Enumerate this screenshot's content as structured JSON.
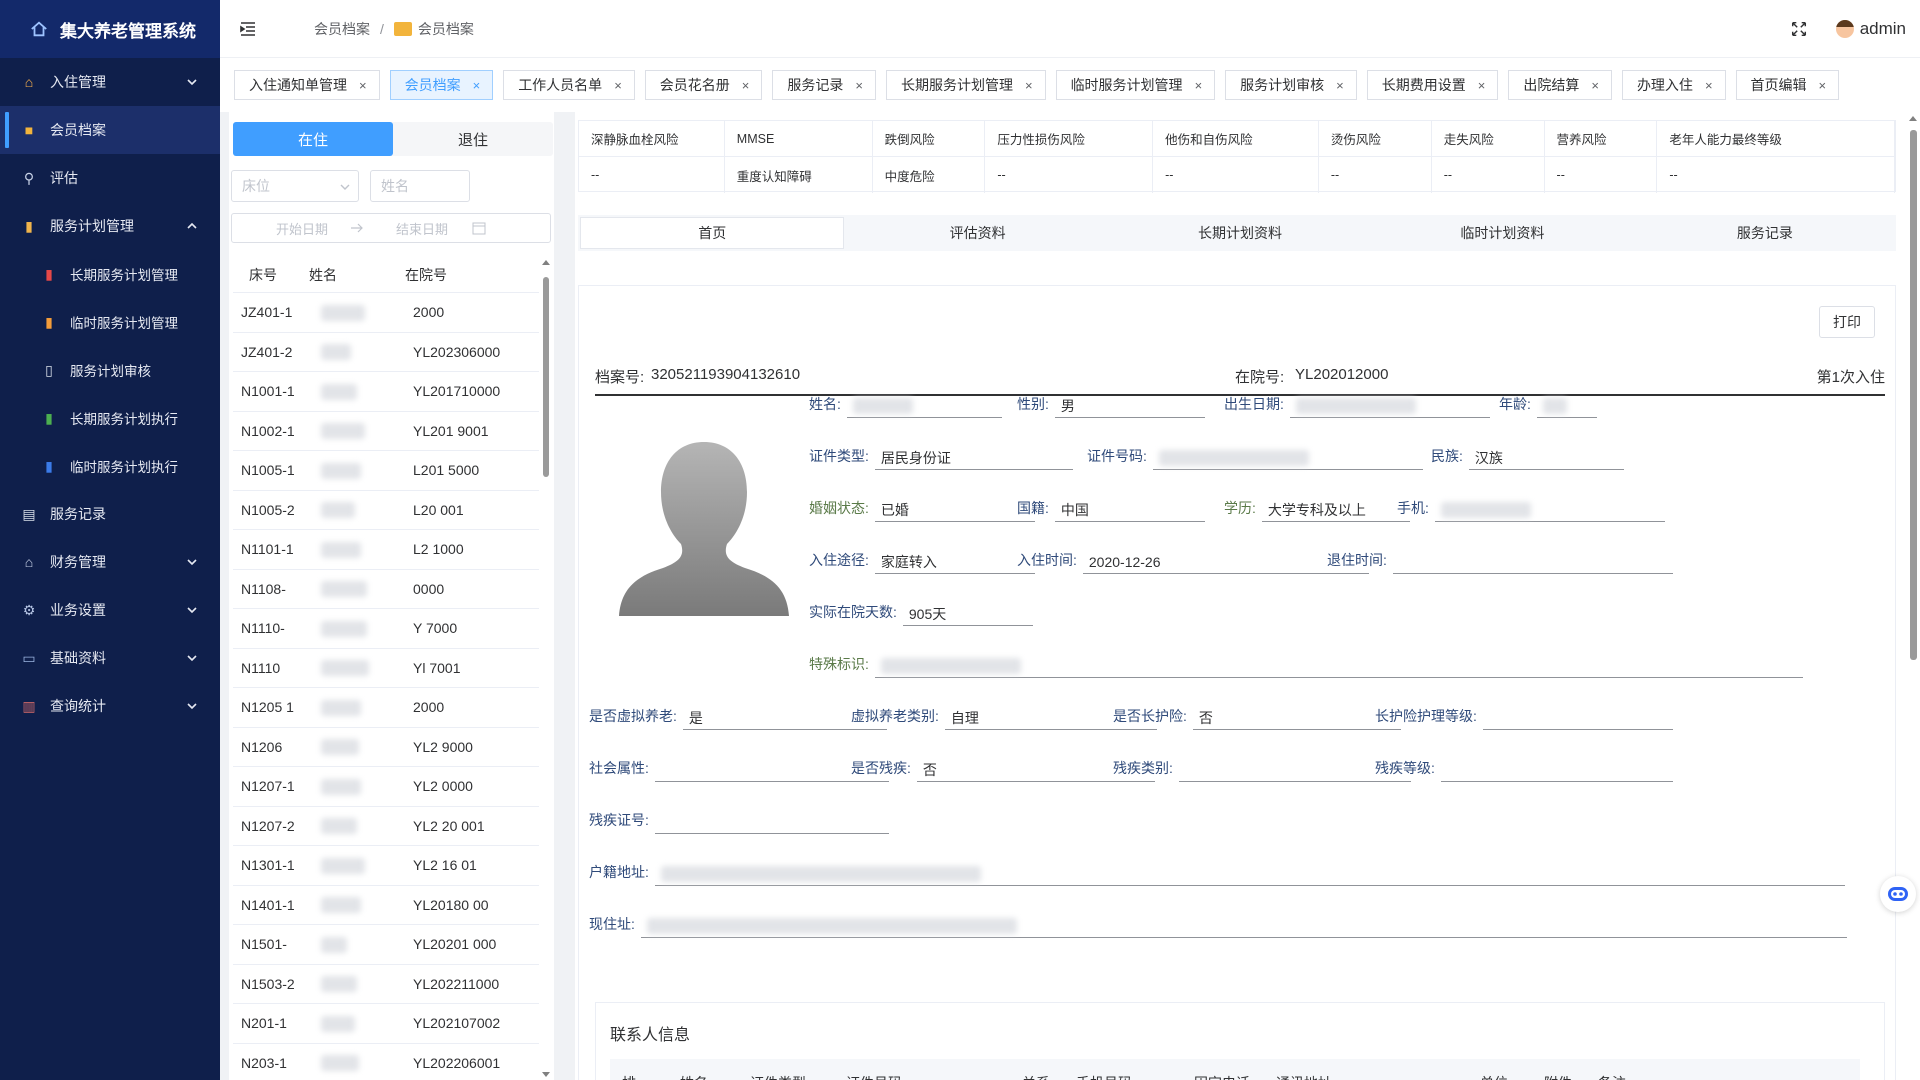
{
  "app": {
    "title": "集大养老管理系统"
  },
  "sidebar": {
    "items": [
      {
        "label": "入住管理",
        "icon": "home-icon",
        "has_caret": true,
        "caret": "down"
      },
      {
        "label": "会员档案",
        "icon": "folder-icon",
        "active": true
      },
      {
        "label": "评估",
        "icon": "magnifier-icon"
      },
      {
        "label": "服务计划管理",
        "icon": "notebook-icon",
        "has_caret": true,
        "caret": "up"
      },
      {
        "label": "长期服务计划管理",
        "icon": "red-book-icon",
        "sub": true
      },
      {
        "label": "临时服务计划管理",
        "icon": "orange-book-icon",
        "sub": true
      },
      {
        "label": "服务计划审核",
        "icon": "page-icon",
        "sub": true
      },
      {
        "label": "长期服务计划执行",
        "icon": "green-book-icon",
        "sub": true
      },
      {
        "label": "临时服务计划执行",
        "icon": "blue-book-icon",
        "sub": true
      },
      {
        "label": "服务记录",
        "icon": "document-icon"
      },
      {
        "label": "财务管理",
        "icon": "bank-icon",
        "has_caret": true,
        "caret": "down"
      },
      {
        "label": "业务设置",
        "icon": "gear-icon",
        "has_caret": true,
        "caret": "down"
      },
      {
        "label": "基础资料",
        "icon": "laptop-icon",
        "has_caret": true,
        "caret": "down"
      },
      {
        "label": "查询统计",
        "icon": "bar-chart-icon",
        "has_caret": true,
        "caret": "down"
      }
    ]
  },
  "header": {
    "breadcrumb": [
      "会员档案",
      "会员档案"
    ],
    "user": "admin"
  },
  "tags": [
    {
      "label": "入住通知单管理"
    },
    {
      "label": "会员档案",
      "active": true
    },
    {
      "label": "工作人员名单"
    },
    {
      "label": "会员花名册"
    },
    {
      "label": "服务记录"
    },
    {
      "label": "长期服务计划管理"
    },
    {
      "label": "临时服务计划管理"
    },
    {
      "label": "服务计划审核"
    },
    {
      "label": "长期费用设置"
    },
    {
      "label": "出院结算"
    },
    {
      "label": "办理入住"
    },
    {
      "label": "首页编辑"
    }
  ],
  "tag_close": "×",
  "left": {
    "seg_in": "在住",
    "seg_out": "退住",
    "bed_placeholder": "床位",
    "name_placeholder": "姓名",
    "start_date": "开始日期",
    "end_date": "结束日期",
    "cols": [
      "床号",
      "姓名",
      "在院号"
    ],
    "rows": [
      {
        "bed": "JZ401-1",
        "no": "2000"
      },
      {
        "bed": "JZ401-2",
        "no": "YL202306000"
      },
      {
        "bed": "N1001-1",
        "no": "YL201710000"
      },
      {
        "bed": "N1002-1",
        "no": "YL201 9001"
      },
      {
        "bed": "N1005-1",
        "no": "L201 5000"
      },
      {
        "bed": "N1005-2",
        "no": "L20 001"
      },
      {
        "bed": "N1101-1",
        "no": "L2 1000"
      },
      {
        "bed": "N1108-",
        "no": "0000"
      },
      {
        "bed": "N1110-",
        "no": "Y 7000"
      },
      {
        "bed": "N1110",
        "no": "Yl 7001"
      },
      {
        "bed": "N1205 1",
        "no": "2000"
      },
      {
        "bed": "N1206",
        "no": "YL2 9000"
      },
      {
        "bed": "N1207-1",
        "no": "YL2 0000"
      },
      {
        "bed": "N1207-2",
        "no": "YL2 20 001"
      },
      {
        "bed": "N1301-1",
        "no": "YL2 16 01"
      },
      {
        "bed": "N1401-1",
        "no": "YL20180 00"
      },
      {
        "bed": "N1501-",
        "no": "YL20201 000"
      },
      {
        "bed": "N1503-2",
        "no": "YL202211000"
      },
      {
        "bed": "N201-1",
        "no": "YL202107002"
      },
      {
        "bed": "N203-1",
        "no": "YL202206001"
      }
    ]
  },
  "risk": {
    "headers": [
      "深静脉血栓风险",
      "MMSE",
      "跌倒风险",
      "压力性损伤风险",
      "他伤和自伤风险",
      "烫伤风险",
      "走失风险",
      "营养风险",
      "老年人能力最终等级"
    ],
    "values": [
      "--",
      "重度认知障碍",
      "中度危险",
      "--",
      "--",
      "--",
      "--",
      "--",
      "--"
    ]
  },
  "detail_tabs": [
    "首页",
    "评估资料",
    "长期计划资料",
    "临时计划资料",
    "服务记录"
  ],
  "profile": {
    "print": "打印",
    "archive_label": "档案号:",
    "archive_no": "320521193904132610",
    "hospital_label": "在院号:",
    "hospital_no": "YL202012000",
    "visit": "第1次入住",
    "fields": {
      "name": "姓名:",
      "gender": "性别:",
      "gender_v": "男",
      "birth": "出生日期:",
      "age": "年龄:",
      "id_type": "证件类型:",
      "id_type_v": "居民身份证",
      "id_no": "证件号码:",
      "ethnic": "民族:",
      "ethnic_v": "汉族",
      "marital": "婚姻状态:",
      "marital_v": "已婚",
      "nationality": "国籍:",
      "nationality_v": "中国",
      "edu": "学历:",
      "edu_v": "大学专科及以上",
      "phone": "手机:",
      "route": "入住途径:",
      "route_v": "家庭转入",
      "checkin": "入住时间:",
      "checkin_v": "2020-12-26",
      "checkout": "退住时间:",
      "days": "实际在院天数:",
      "days_v": "905天",
      "special": "特殊标识:",
      "virtual": "是否虚拟养老:",
      "virtual_v": "是",
      "virtual_type": "虚拟养老类别:",
      "virtual_type_v": "自理",
      "ltc": "是否长护险:",
      "ltc_v": "否",
      "ltc_level": "长护险护理等级:",
      "social": "社会属性:",
      "disabled": "是否残疾:",
      "disabled_v": "否",
      "dis_type": "残疾类别:",
      "dis_level": "残疾等级:",
      "dis_cert": "残疾证号:",
      "hukou": "户籍地址:",
      "address": "现住址:"
    }
  },
  "contact": {
    "title": "联系人信息",
    "cols": [
      "排",
      "姓名",
      "证件类型",
      "证件号码",
      "关系",
      "手机号码",
      "固定电话",
      "通讯地址",
      "单位",
      "附件",
      "备注"
    ]
  }
}
